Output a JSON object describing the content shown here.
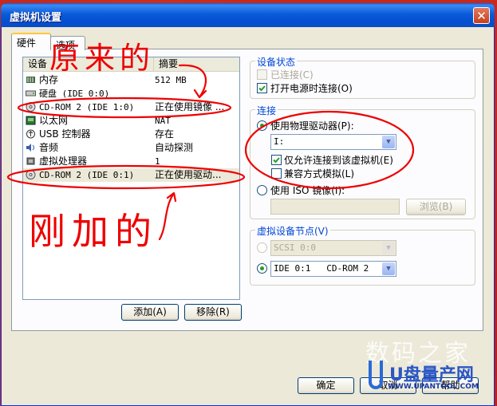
{
  "window": {
    "title": "虚拟机设置",
    "close_glyph": "✕"
  },
  "tabs": [
    {
      "label": "硬件"
    },
    {
      "label": "选项"
    }
  ],
  "device_list": {
    "columns": [
      "设备",
      "摘要"
    ],
    "rows": [
      {
        "icon": "memory-icon",
        "name": "内存",
        "summary": "512 MB"
      },
      {
        "icon": "harddisk-icon",
        "name": "硬盘 (IDE 0:0)",
        "summary": ""
      },
      {
        "icon": "cdrom-icon",
        "name": "CD-ROM 2 (IDE 1:0)",
        "summary": "正在使用镜像 ..."
      },
      {
        "icon": "network-icon",
        "name": "以太网",
        "summary": "NAT"
      },
      {
        "icon": "usb-icon",
        "name": "USB 控制器",
        "summary": "存在"
      },
      {
        "icon": "sound-icon",
        "name": "音频",
        "summary": "自动探测"
      },
      {
        "icon": "cpu-icon",
        "name": "虚拟处理器",
        "summary": "1"
      },
      {
        "icon": "cdrom-icon",
        "name": "CD-ROM 2 (IDE 0:1)",
        "summary": "正在使用驱动..."
      }
    ],
    "add_button": "添加(A)",
    "remove_button": "移除(R)"
  },
  "device_status": {
    "title": "设备状态",
    "connected": {
      "label": "已连接(C)",
      "checked": false,
      "disabled": true
    },
    "connect_on_power": {
      "label": "打开电源时连接(O)",
      "checked": true
    }
  },
  "connection": {
    "title": "连接",
    "physical_drive": {
      "label": "使用物理驱动器(P):",
      "selected": true
    },
    "drive_value": "I:",
    "exclusive": {
      "label": "仅允许连接到该虚拟机(E)",
      "checked": true
    },
    "legacy": {
      "label": "兼容方式模拟(L)",
      "checked": false
    },
    "iso_image": {
      "label": "使用 ISO 镜像(I):",
      "selected": false
    },
    "iso_path": "",
    "browse_button": "浏览(B)"
  },
  "virtual_node": {
    "title": "虚拟设备节点(V)",
    "scsi": {
      "value": "SCSI 0:0",
      "selected": false
    },
    "ide": {
      "value": "IDE 0:1   CD-ROM 2",
      "selected": true
    }
  },
  "footer": {
    "ok": "确定",
    "cancel": "取消",
    "help": "帮助"
  },
  "annotations": {
    "top": "原来的",
    "bottom": "刚加的",
    "color": "#ee0000"
  },
  "watermark": {
    "text": "数码之家",
    "logo": "U盘量产网",
    "url": "WWW.UPANTOOL.COM"
  }
}
